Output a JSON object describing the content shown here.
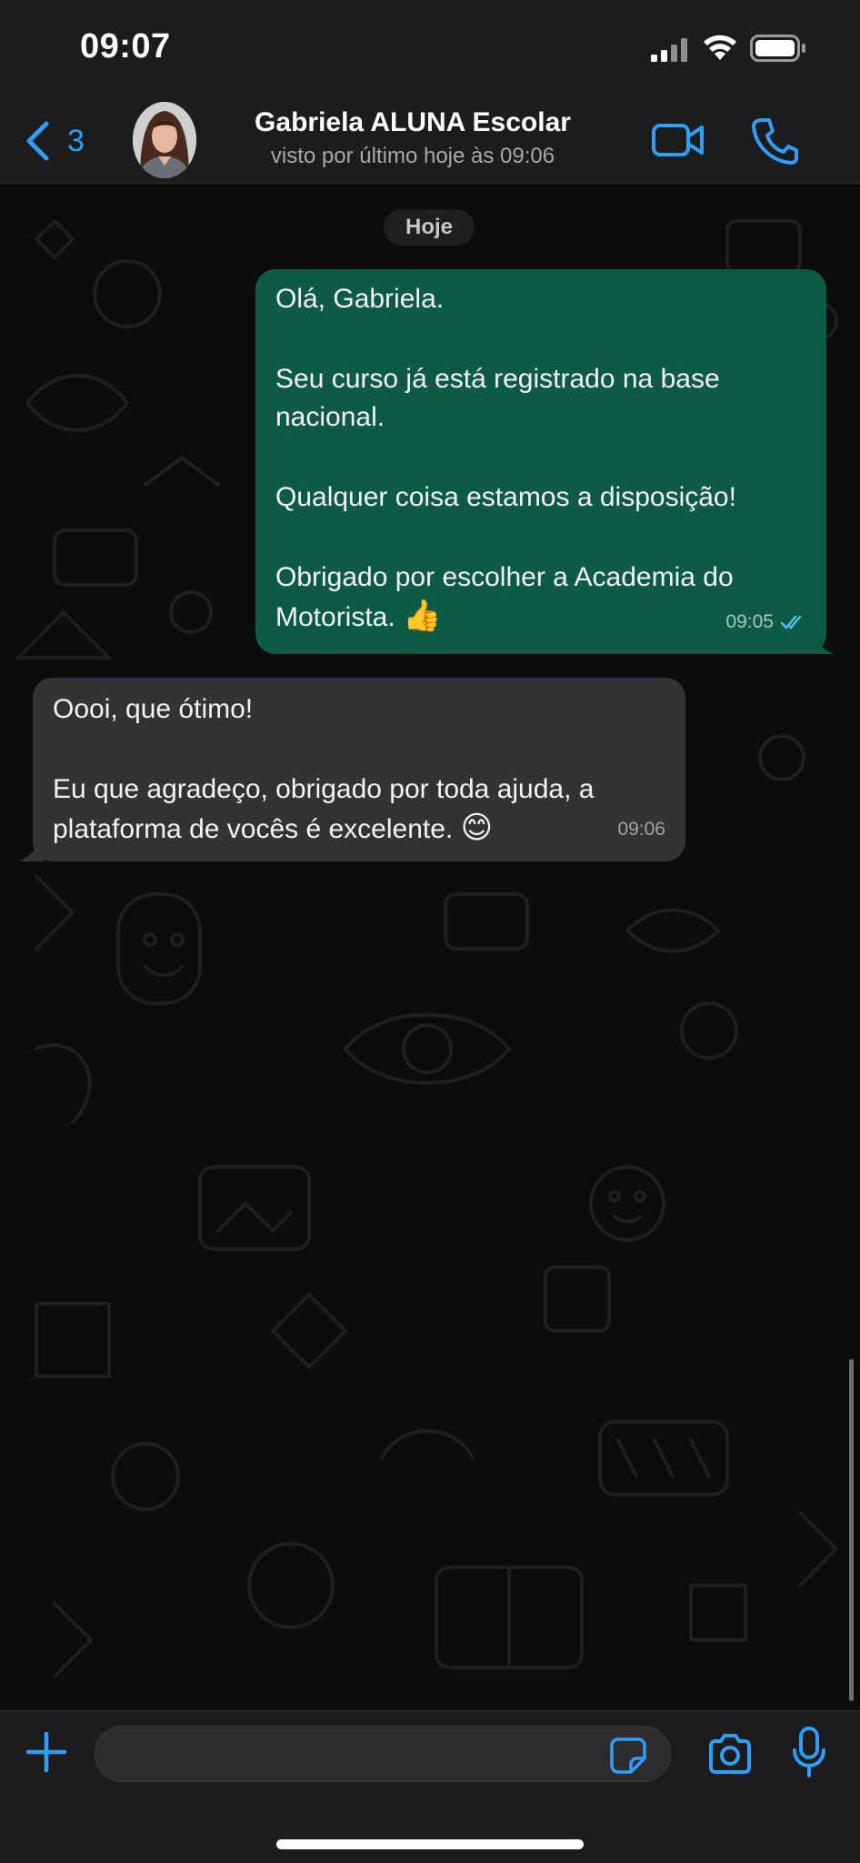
{
  "status_bar": {
    "time": "09:07"
  },
  "header": {
    "back_count": "3",
    "contact_name": "Gabriela ALUNA Escolar",
    "contact_status": "visto por último hoje às 09:06"
  },
  "chat": {
    "date_label": "Hoje",
    "outgoing": {
      "line1": "Olá, Gabriela.",
      "line2": "Seu curso já está registrado na base",
      "line3": "nacional.",
      "line4": "Qualquer coisa estamos a disposição!",
      "line5": "Obrigado por escolher a Academia do",
      "line6": "Motorista.",
      "emoji": "👍",
      "time": "09:05"
    },
    "incoming": {
      "line1": "Oooi, que ótimo!",
      "line2": "Eu que agradeço, obrigado por toda ajuda, a",
      "line3": "plataforma de vocês é excelente.",
      "emoji": "😊",
      "time": "09:06"
    }
  },
  "input": {
    "placeholder": ""
  },
  "colors": {
    "accent": "#2f9ef5",
    "outgoing_bubble": "#0d5a47",
    "incoming_bubble": "#333335",
    "bar_background": "#1c1c1e"
  },
  "icons": [
    "signal-icon",
    "wifi-icon",
    "battery-icon",
    "chevron-left-icon",
    "video-camera-icon",
    "phone-icon",
    "double-check-icon",
    "plus-icon",
    "sticker-icon",
    "camera-icon",
    "microphone-icon"
  ]
}
